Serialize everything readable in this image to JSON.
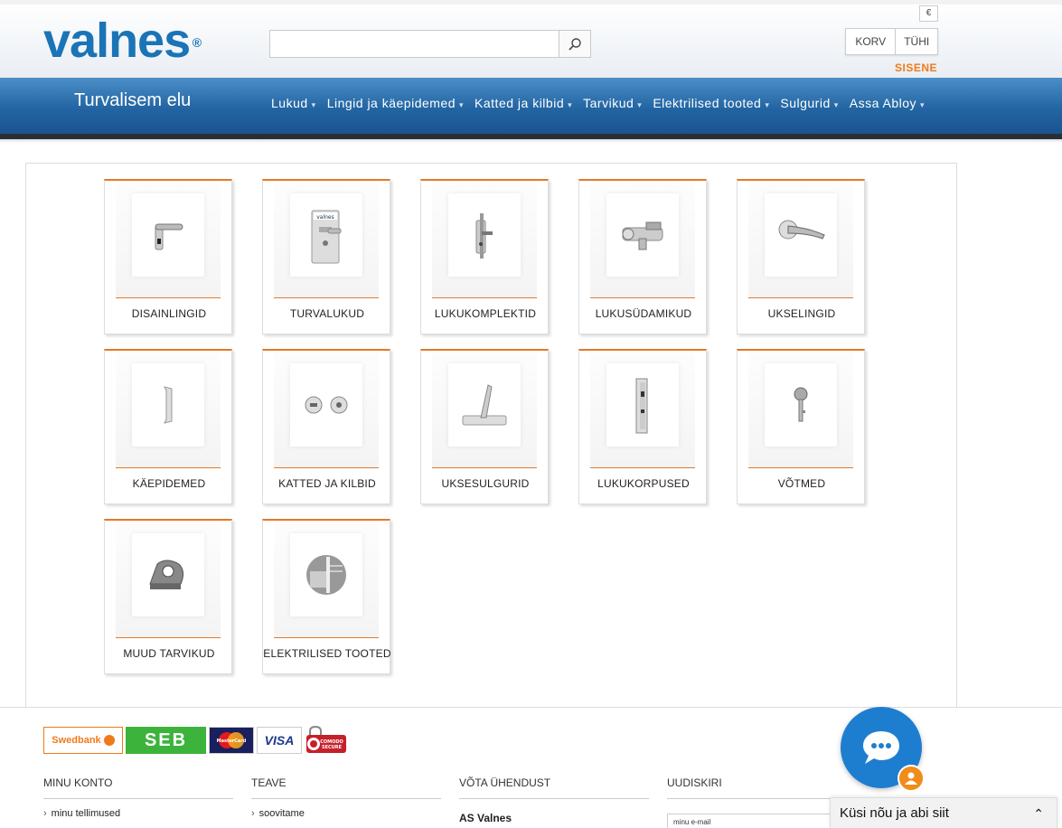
{
  "header": {
    "logo": "valnes",
    "logo_reg": "®",
    "search": {
      "value": "",
      "placeholder": ""
    },
    "currency": "€",
    "cart_label": "KORV",
    "cart_status": "TÜHI",
    "login": "SISENE"
  },
  "nav": {
    "tagline": "Turvalisem elu",
    "items": [
      {
        "label": "Lukud"
      },
      {
        "label": "Lingid ja käepidemed"
      },
      {
        "label": "Katted ja kilbid"
      },
      {
        "label": "Tarvikud"
      },
      {
        "label": "Elektrilised tooted"
      },
      {
        "label": "Sulgurid"
      },
      {
        "label": "Assa Abloy"
      }
    ]
  },
  "categories": [
    {
      "label": "DISAINLINGID",
      "icon": "door-handle-icon"
    },
    {
      "label": "TURVALUKUD",
      "icon": "security-lock-icon"
    },
    {
      "label": "LUKUKOMPLEKTID",
      "icon": "lock-set-icon"
    },
    {
      "label": "LUKUSÜDAMIKUD",
      "icon": "lock-cylinder-icon"
    },
    {
      "label": "UKSELINGID",
      "icon": "lever-handle-icon"
    },
    {
      "label": "KÄEPIDEMED",
      "icon": "pull-handle-icon"
    },
    {
      "label": "KATTED JA KILBID",
      "icon": "escutcheon-icon"
    },
    {
      "label": "UKSESULGURID",
      "icon": "door-closer-icon"
    },
    {
      "label": "LUKUKORPUSED",
      "icon": "lock-body-icon"
    },
    {
      "label": "VÕTMED",
      "icon": "key-icon"
    },
    {
      "label": "MUUD TARVIKUD",
      "icon": "door-stop-icon"
    },
    {
      "label": "ELEKTRILISED TOOTED",
      "icon": "electric-strike-icon"
    }
  ],
  "footer": {
    "payments": [
      "Swedbank",
      "SEB",
      "MasterCard",
      "VISA",
      "COMODO SECURE"
    ],
    "columns": [
      {
        "head": "MINU KONTO",
        "first": "minu tellimused"
      },
      {
        "head": "TEAVE",
        "first": "soovitame"
      },
      {
        "head": "VÕTA ÜHENDUST",
        "first": "AS Valnes"
      },
      {
        "head": "UUDISKIRI",
        "first": "minu e-mail"
      }
    ]
  },
  "chat": {
    "label": "Küsi nõu ja abi siit",
    "chevron": "⌃"
  }
}
